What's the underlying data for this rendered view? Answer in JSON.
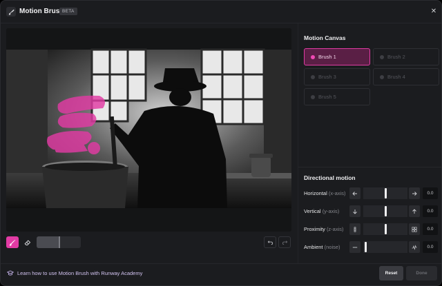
{
  "header": {
    "title": "Motion Brush",
    "badge": "BETA",
    "icon": "brush-icon",
    "close_icon": "close-icon"
  },
  "canvas": {
    "image_description": "Black and white photo of a man stirring a barrel by a window",
    "overlay_color": "#e23ba4"
  },
  "toolbar": {
    "brush_icon": "brush-icon",
    "eraser_icon": "eraser-icon",
    "brush_size": 0.5,
    "undo_icon": "undo-icon",
    "redo_icon": "redo-icon"
  },
  "motion_canvas": {
    "title": "Motion Canvas",
    "brushes": [
      {
        "label": "Brush 1",
        "active": true
      },
      {
        "label": "Brush 2",
        "active": false
      },
      {
        "label": "Brush 3",
        "active": false
      },
      {
        "label": "Brush 4",
        "active": false
      },
      {
        "label": "Brush 5",
        "active": false
      }
    ]
  },
  "directional_motion": {
    "title": "Directional motion",
    "rows": [
      {
        "label": "Horizontal",
        "axis": "(x-axis)",
        "value": "0.0",
        "level": 0.5,
        "left_icon": "arrow-left-icon",
        "right_icon": "arrow-right-icon"
      },
      {
        "label": "Vertical",
        "axis": "(y-axis)",
        "value": "0.0",
        "level": 0.5,
        "left_icon": "arrow-down-icon",
        "right_icon": "arrow-up-icon"
      },
      {
        "label": "Proximity",
        "axis": "(z-axis)",
        "value": "0.0",
        "level": 0.5,
        "left_icon": "proximity-far-icon",
        "right_icon": "proximity-near-icon"
      },
      {
        "label": "Ambient",
        "axis": "(noise)",
        "value": "0.0",
        "level": 0.0,
        "left_icon": "ambient-flat-icon",
        "right_icon": "ambient-wave-icon"
      }
    ]
  },
  "footer": {
    "academy_link": "Learn how to use Motion Brush with Runway Academy",
    "academy_icon": "graduation-cap-icon",
    "reset_label": "Reset",
    "done_label": "Done"
  },
  "colors": {
    "accent": "#e23ba4",
    "background": "#1b1c1f"
  }
}
